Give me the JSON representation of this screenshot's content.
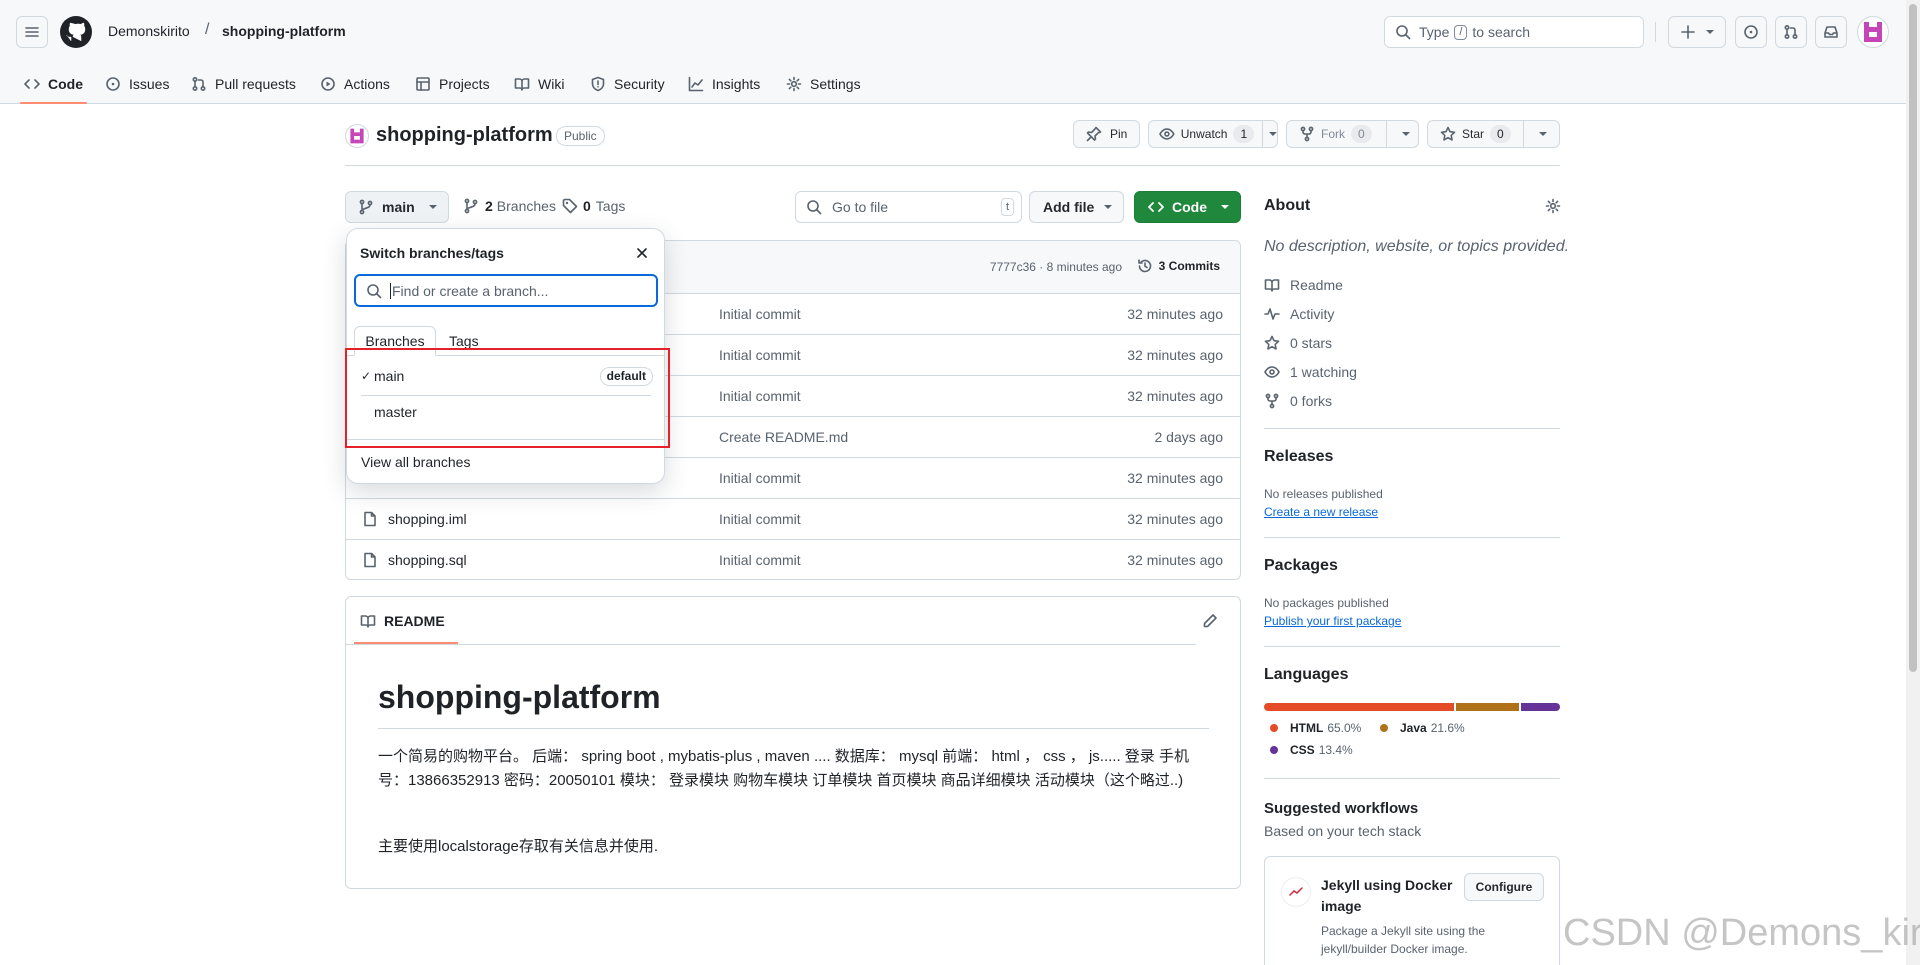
{
  "header": {
    "owner": "Demonskirito",
    "separator": "/",
    "repo": "shopping-platform",
    "search": {
      "type_label": "Type",
      "key": "/",
      "suffix": "to search"
    }
  },
  "nav_tabs": [
    {
      "label": "Code"
    },
    {
      "label": "Issues"
    },
    {
      "label": "Pull requests"
    },
    {
      "label": "Actions"
    },
    {
      "label": "Projects"
    },
    {
      "label": "Wiki"
    },
    {
      "label": "Security"
    },
    {
      "label": "Insights"
    },
    {
      "label": "Settings"
    }
  ],
  "repo": {
    "title": "shopping-platform",
    "visibility": "Public",
    "pin_label": "Pin",
    "unwatch_label": "Unwatch",
    "unwatch_count": "1",
    "fork_label": "Fork",
    "fork_count": "0",
    "star_label": "Star",
    "star_count": "0"
  },
  "toolbar": {
    "branch": "main",
    "branches_count": "2",
    "branches_label": "Branches",
    "tags_count": "0",
    "tags_label": "Tags",
    "goto_placeholder": "Go to file",
    "goto_key": "t",
    "add_file_label": "Add file",
    "code_label": "Code"
  },
  "commit_bar": {
    "hash_time": "7777c36 · 8 minutes ago",
    "commits_label": "3 Commits"
  },
  "files": [
    {
      "name": "",
      "commit": "Initial commit",
      "time": "32 minutes ago"
    },
    {
      "name": "",
      "commit": "Initial commit",
      "time": "32 minutes ago"
    },
    {
      "name": "",
      "commit": "Initial commit",
      "time": "32 minutes ago"
    },
    {
      "name": "",
      "commit": "Create README.md",
      "time": "2 days ago"
    },
    {
      "name": "",
      "commit": "Initial commit",
      "time": "32 minutes ago"
    },
    {
      "name": "shopping.iml",
      "commit": "Initial commit",
      "time": "32 minutes ago"
    },
    {
      "name": "shopping.sql",
      "commit": "Initial commit",
      "time": "32 minutes ago"
    }
  ],
  "dropdown": {
    "title": "Switch branches/tags",
    "placeholder": "Find or create a branch...",
    "tab_branches": "Branches",
    "tab_tags": "Tags",
    "branches": [
      {
        "name": "main",
        "badge": "default",
        "checked": true
      },
      {
        "name": "master",
        "badge": "",
        "checked": false
      }
    ],
    "view_all": "View all branches"
  },
  "readme": {
    "tab_label": "README",
    "heading": "shopping-platform",
    "para1": "一个简易的购物平台。 后端： spring boot , mybatis-plus , maven .... 数据库： mysql 前端： html ， css ， js..... 登录 手机号：13866352913 密码：20050101 模块： 登录模块 购物车模块 订单模块 首页模块 商品详细模块 活动模块（这个略过..)",
    "para2": "主要使用localstorage存取有关信息并使用."
  },
  "about": {
    "title": "About",
    "description": "No description, website, or topics provided.",
    "items": [
      {
        "icon": "book-icon",
        "label": "Readme"
      },
      {
        "icon": "pulse-icon",
        "label": "Activity"
      },
      {
        "icon": "star-icon",
        "label": "0 stars"
      },
      {
        "icon": "eye-icon",
        "label": "1 watching"
      },
      {
        "icon": "fork-icon",
        "label": "0 forks"
      }
    ]
  },
  "releases": {
    "title": "Releases",
    "text": "No releases published",
    "link": "Create a new release"
  },
  "packages": {
    "title": "Packages",
    "text": "No packages published",
    "link": "Publish your first package"
  },
  "languages": {
    "title": "Languages",
    "items": [
      {
        "name": "HTML",
        "percent": "65.0%",
        "value": 65.0,
        "color": "#e34c26"
      },
      {
        "name": "Java",
        "percent": "21.6%",
        "value": 21.6,
        "color": "#b07219"
      },
      {
        "name": "CSS",
        "percent": "13.4%",
        "value": 13.4,
        "color": "#663399"
      }
    ]
  },
  "workflows": {
    "title": "Suggested workflows",
    "subtitle": "Based on your tech stack",
    "card_title": "Jekyll using Docker image",
    "card_desc": "Package a Jekyll site using the jekyll/builder Docker image.",
    "configure_label": "Configure"
  },
  "watermark": "CSDN @Demons_kirit",
  "colors": {
    "highlight": "#e5202a",
    "code_button": "#1f883d",
    "link": "#0969da"
  }
}
